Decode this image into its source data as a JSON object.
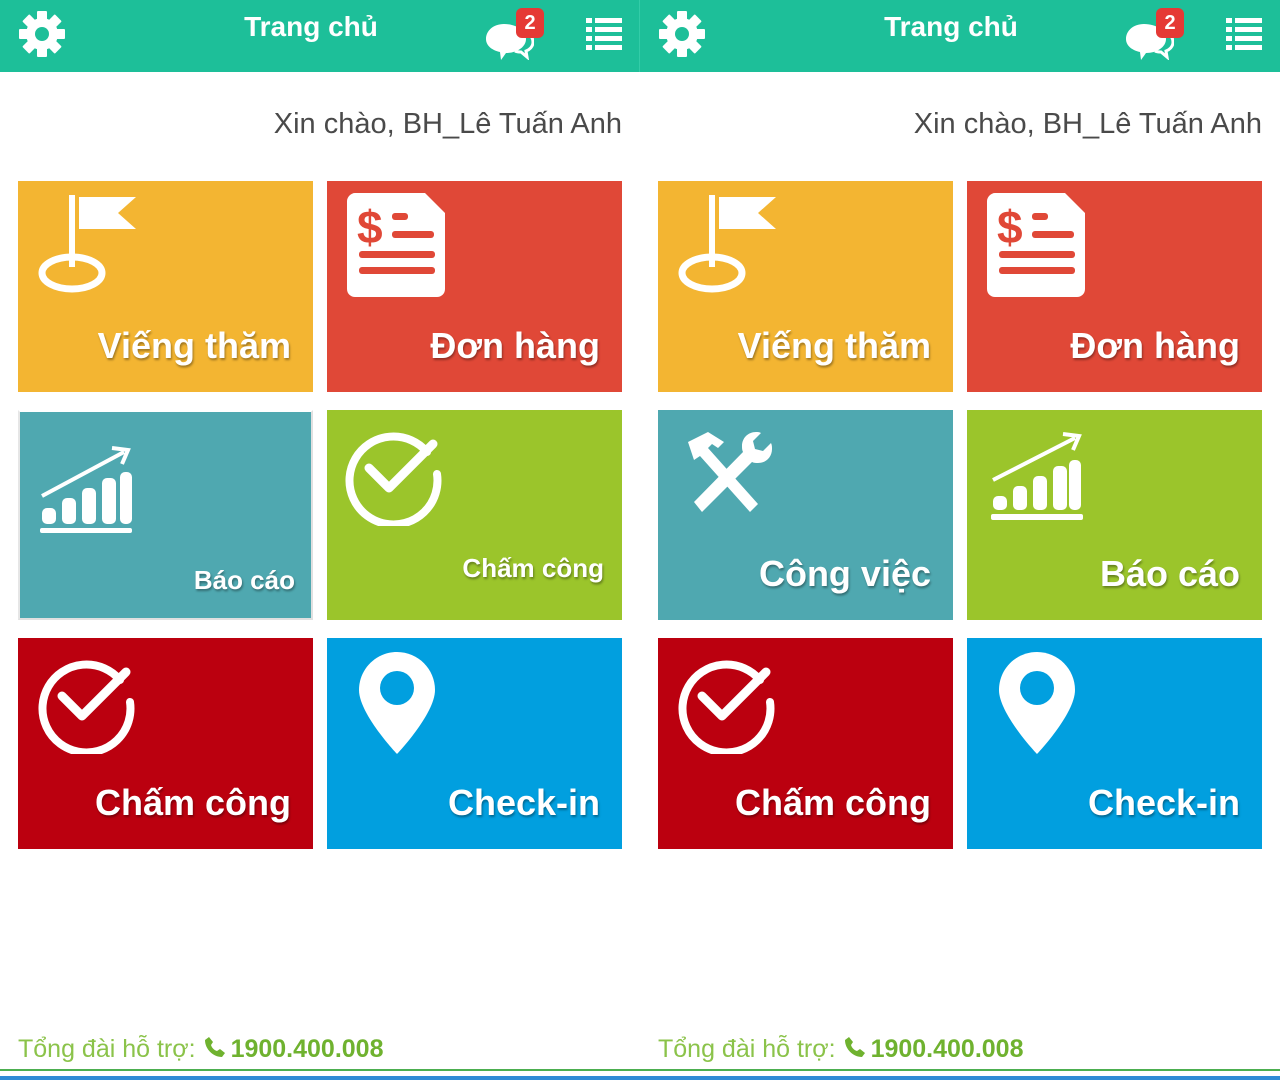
{
  "screens": [
    {
      "header": {
        "title": "Trang chủ",
        "badge_count": "2",
        "settings_icon": "gear-icon",
        "chat_icon": "chat-icon",
        "menu_icon": "list-icon"
      },
      "greeting": "Xin chào, BH_Lê Tuấn Anh",
      "tiles": [
        {
          "label": "Viếng thăm",
          "icon": "flag-icon",
          "color": "#f3b532"
        },
        {
          "label": "Đơn hàng",
          "icon": "invoice-icon",
          "color": "#e04837"
        },
        {
          "label": "Báo cáo",
          "icon": "chart-icon",
          "color": "#4fa8b0"
        },
        {
          "label": "Chấm công",
          "icon": "check-circle-icon",
          "color": "#9bc52b"
        },
        {
          "label": "Chấm công",
          "icon": "check-circle-icon",
          "color": "#bb000f"
        },
        {
          "label": "Check-in",
          "icon": "map-pin-icon",
          "color": "#019fdf"
        }
      ],
      "support": {
        "label": "Tổng đài hỗ trợ:",
        "phone": "1900.400.008"
      }
    },
    {
      "header": {
        "title": "Trang chủ",
        "badge_count": "2",
        "settings_icon": "gear-icon",
        "chat_icon": "chat-icon",
        "menu_icon": "list-icon"
      },
      "greeting": "Xin chào, BH_Lê Tuấn Anh",
      "tiles": [
        {
          "label": "Viếng thăm",
          "icon": "flag-icon",
          "color": "#f3b532"
        },
        {
          "label": "Đơn hàng",
          "icon": "invoice-icon",
          "color": "#e04837"
        },
        {
          "label": "Công việc",
          "icon": "tools-icon",
          "color": "#4fa8b0"
        },
        {
          "label": "Báo cáo",
          "icon": "chart-icon",
          "color": "#9bc52b"
        },
        {
          "label": "Chấm công",
          "icon": "check-circle-icon",
          "color": "#bb000f"
        },
        {
          "label": "Check-in",
          "icon": "map-pin-icon",
          "color": "#019fdf"
        }
      ],
      "support": {
        "label": "Tổng đài hỗ trợ:",
        "phone": "1900.400.008"
      }
    }
  ]
}
